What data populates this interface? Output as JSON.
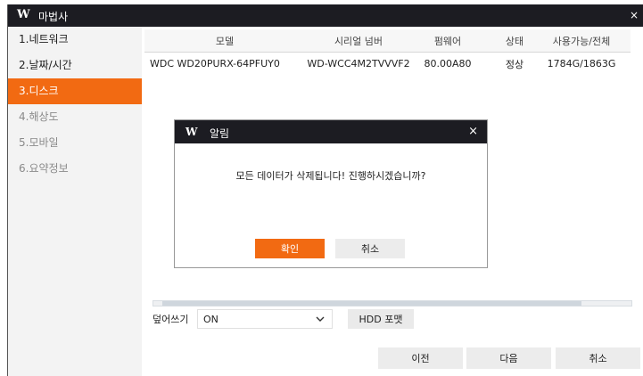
{
  "window": {
    "logo": "W",
    "title": "마법사",
    "close_glyph": "×"
  },
  "sidebar": {
    "items": [
      {
        "label": "1.네트워크"
      },
      {
        "label": "2.날짜/시간"
      },
      {
        "label": "3.디스크"
      },
      {
        "label": "4.해상도"
      },
      {
        "label": "5.모바일"
      },
      {
        "label": "6.요약정보"
      }
    ]
  },
  "table": {
    "headers": [
      "모델",
      "시리얼 넘버",
      "펌웨어",
      "상태",
      "사용가능/전체"
    ],
    "rows": [
      [
        "WDC WD20PURX-64PFUY0",
        "WD-WCC4M2TVVVF2",
        "80.00A80",
        "정상",
        "1784G/1863G"
      ]
    ]
  },
  "overwrite": {
    "label": "덮어쓰기",
    "value": "ON"
  },
  "hdd_format_label": "HDD 포맷",
  "footer": {
    "prev": "이전",
    "next": "다음",
    "cancel": "취소"
  },
  "dialog": {
    "logo": "W",
    "title": "알림",
    "close_glyph": "×",
    "message": "모든 데이터가 삭제됩니다! 진행하시겠습니까?",
    "ok": "확인",
    "cancel": "취소"
  },
  "colors": {
    "accent": "#f26a12",
    "titlebar": "#1c1c22"
  },
  "icons": {
    "select_chevron": "chevron-down-icon"
  }
}
